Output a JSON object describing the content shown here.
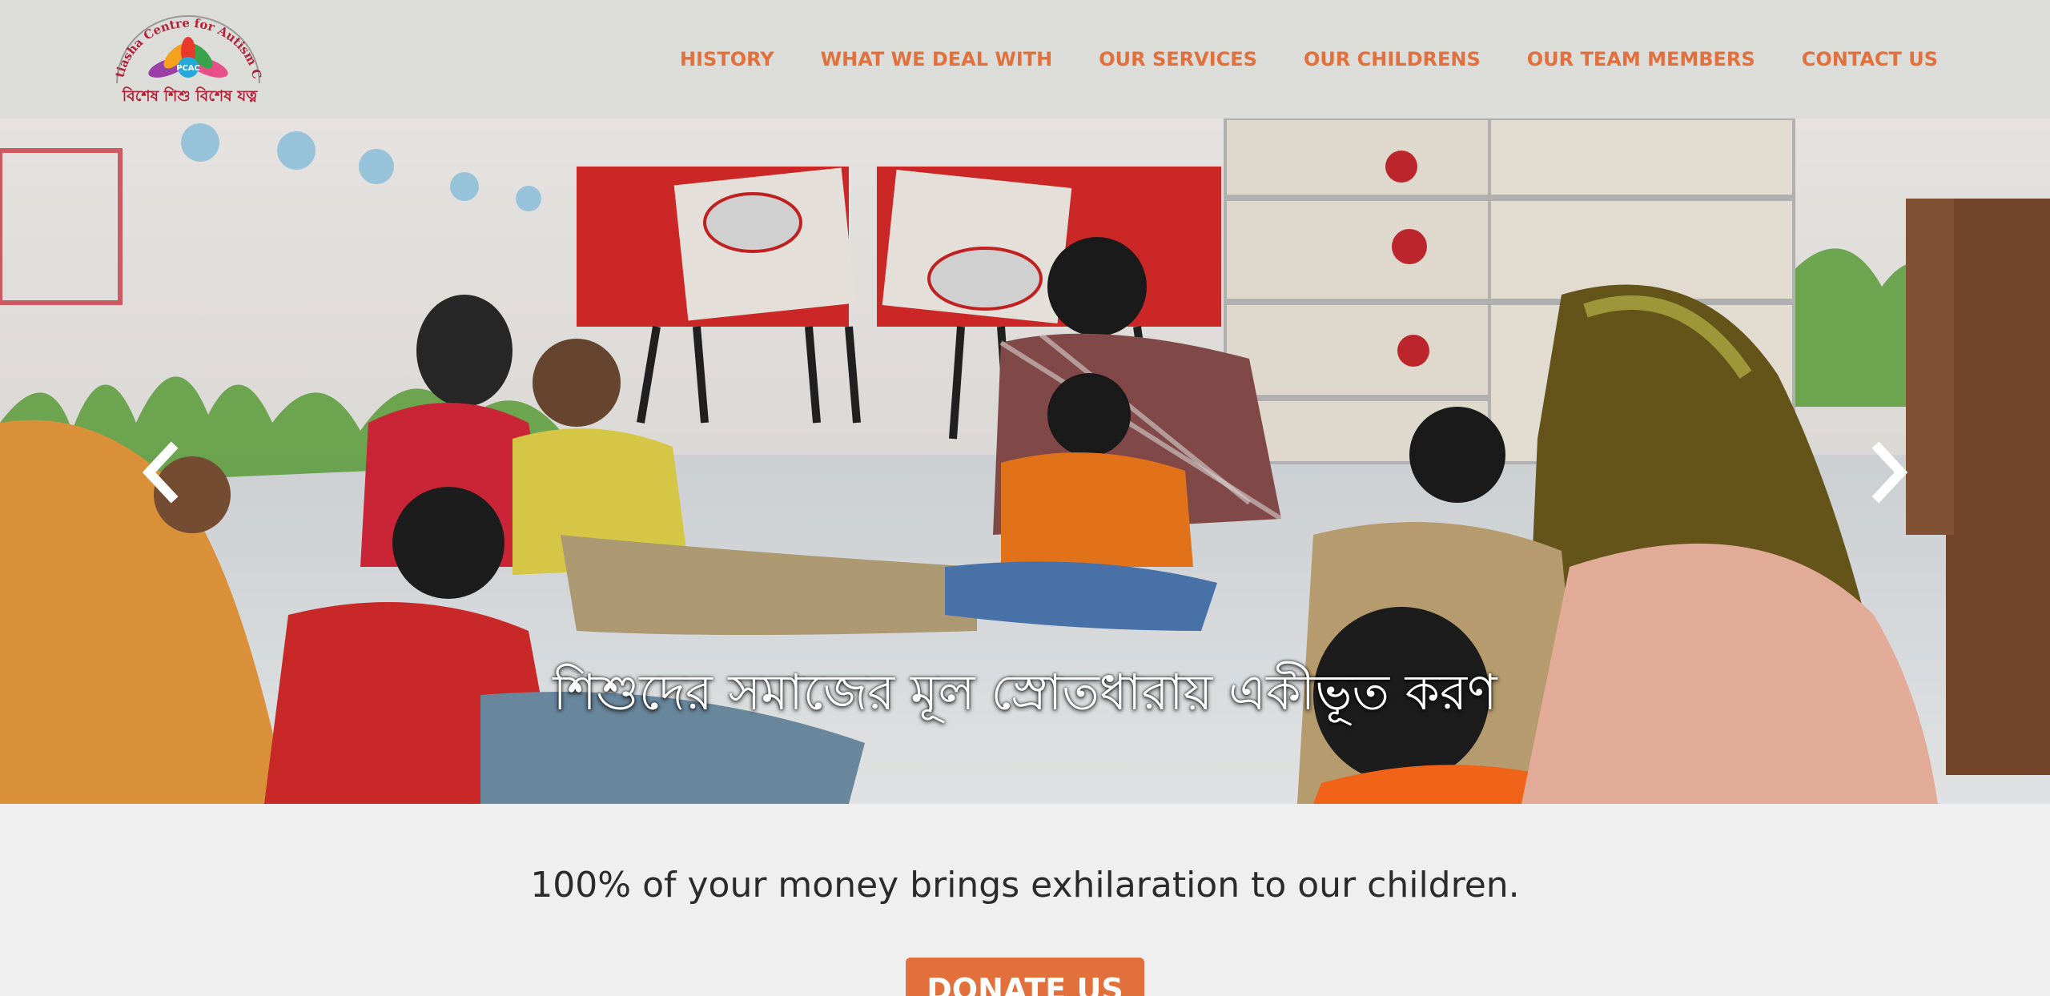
{
  "brand": {
    "name_arc": "Protiasha Centre for Autism Care",
    "badge": "PCAC",
    "tagline_bn": "বিশেষ শিশু বিশেষ যত্ন"
  },
  "nav": {
    "items": [
      {
        "label": "HISTORY"
      },
      {
        "label": "WHAT WE DEAL WITH"
      },
      {
        "label": "OUR SERVICES"
      },
      {
        "label": "OUR CHILDRENS"
      },
      {
        "label": "OUR TEAM MEMBERS"
      },
      {
        "label": "CONTACT US"
      }
    ]
  },
  "hero": {
    "caption": "শিশুদের সমাজের মূল স্রোতধারায় একীভূত করণ",
    "prev_icon": "chevron-left-icon",
    "next_icon": "chevron-right-icon"
  },
  "main": {
    "tagline": "100% of your money brings exhilaration to our children.",
    "donate_label": "DONATE US"
  },
  "colors": {
    "accent": "#e2703c",
    "navbar_bg": "#dcdcd8",
    "page_bg": "#efefef",
    "logo_red": "#b2233a"
  }
}
